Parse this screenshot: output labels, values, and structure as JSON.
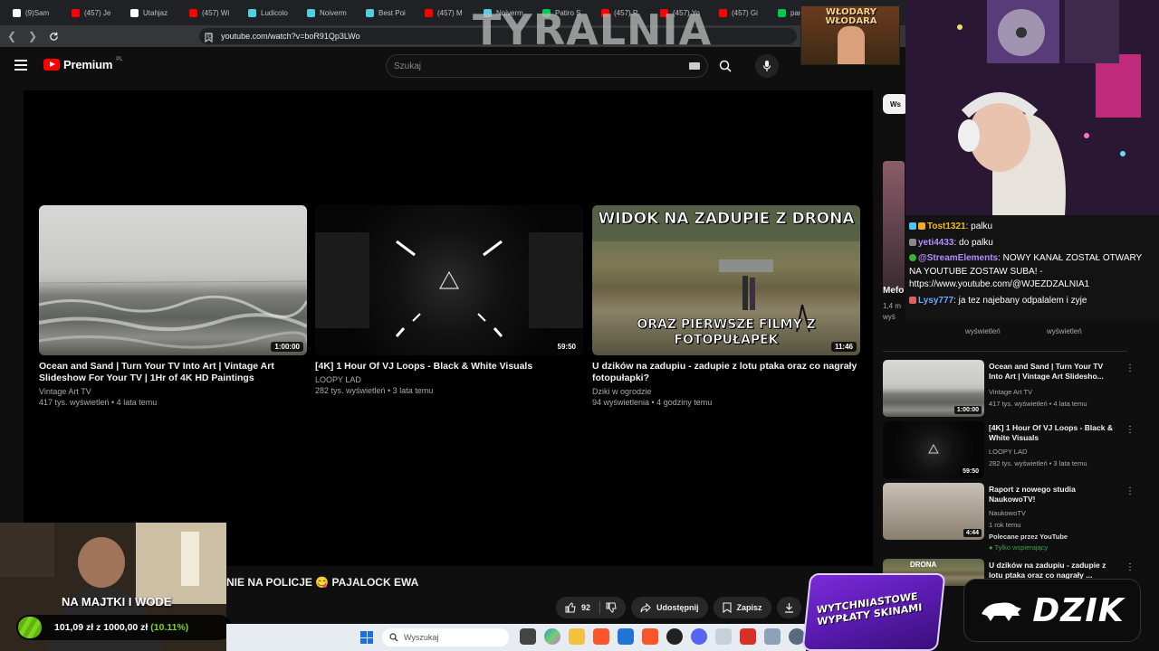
{
  "browser": {
    "tabs": [
      "(9)Sam",
      "(457) Je",
      "Utahjaz",
      "(457) Wi",
      "Ludicolo",
      "Noiverm",
      "Best Poi",
      "(457) M",
      "Noiverm",
      "Patiro S",
      "(457) R",
      "(457) Yo",
      "(457) Gi",
      "paramo"
    ],
    "tab_colors": [
      "#ffffff",
      "#ff0000",
      "#ffffff",
      "#ff0000",
      "#4dd0e1",
      "#4dd0e1",
      "#4dd0e1",
      "#ff0000",
      "#4dd0e1",
      "#00c853",
      "#ff0000",
      "#ff0000",
      "#ff0000",
      "#00c853"
    ],
    "url": "youtube.com/watch?v=boR91Qp3LWo"
  },
  "overlay": {
    "logo": "TYRALNIA",
    "wlodary": "WŁODARY WŁODARA",
    "player_text": "NIE NA POLICJE 😋 PAJALOCK EWA",
    "goal_title": "NA MAJTKI I WODE",
    "goal_current": "101,09 zł",
    "goal_sep": "z",
    "goal_target": "1000,00 zł",
    "goal_percent": "(10.11%)",
    "goal_fraction": 0.1011,
    "brand": "DZIK",
    "promo": "WYTCHNIASTOWE WYPŁATY SKINAMI"
  },
  "youtube": {
    "brand": "Premium",
    "region": "PL",
    "search_placeholder": "Szukaj",
    "endscreen": [
      {
        "title": "Ocean and Sand | Turn Your TV Into Art | Vintage Art Slideshow For Your TV | 1Hr of 4K HD Paintings",
        "channel": "Vintage Art TV",
        "meta": "417 tys. wyświetleń • 4 lata temu",
        "duration": "1:00:00"
      },
      {
        "title": "[4K] 1 Hour Of VJ Loops - Black & White Visuals",
        "channel": "LOOPY LAD",
        "meta": "282 tys. wyświetleń • 3 lata temu",
        "duration": "59:50"
      },
      {
        "title": "U dzików na zadupiu - zadupie z lotu ptaka oraz co nagrały fotopułapki?",
        "channel": "Dziki w ogrodzie",
        "meta": "94 wyświetlenia • 4 godziny temu",
        "duration": "11:46",
        "thumb_top": "WIDOK NA ZADUPIE Z DRONA",
        "thumb_bottom": "ORAZ PIERWSZE FILMY Z FOTOPUŁAPEK"
      }
    ],
    "actions": {
      "likes": "92",
      "share": "Udostępnij",
      "save": "Zapisz"
    },
    "chips": [
      "Ws"
    ],
    "side_partial": {
      "title": "Mefo",
      "meta1": "1,4 m",
      "meta2": "wyś",
      "views_label_1": "wyświetleń",
      "views_label_2": "wyświetleń"
    },
    "recommendations": [
      {
        "title": "Ocean and Sand | Turn Your TV Into Art | Vintage Art Slidesho...",
        "channel": "Vintage Art TV",
        "meta": "417 tys. wyświetleń • 4 lata temu",
        "duration": "1:00:00"
      },
      {
        "title": "[4K] 1 Hour Of VJ Loops - Black & White Visuals",
        "channel": "LOOPY LAD",
        "meta": "282 tys. wyświetleń • 3 lata temu",
        "duration": "59:50"
      },
      {
        "title": "Raport z nowego studia NaukowoTV!",
        "channel": "NaukowoTV",
        "meta": "1 rok temu",
        "extra": "Polecane przez YouTube",
        "badge": "Tylko wspierający",
        "duration": "4:44"
      },
      {
        "title": "U dzików na zadupiu - zadupie z lotu ptaka oraz co nagrały ...",
        "thumb_text": "DRONA"
      }
    ]
  },
  "chat": [
    {
      "user": "Tost1321",
      "color": "#f0c000",
      "text": ": palku"
    },
    {
      "user": "yeti4433",
      "color": "#b58cff",
      "text": ": do palku"
    },
    {
      "user": "@StreamElements",
      "color": "#b58cff",
      "text": ": NOWY KANAŁ ZOSTAŁ OTWARY NA YOUTUBE ZOSTAW SUBA! - https://www.youtube.com/@WJEZDZALNIA1"
    },
    {
      "user": "Lysy777",
      "color": "#6fa8ff",
      "text": ": ja tez najebany odpalalem i zyje"
    }
  ],
  "taskbar": {
    "search_placeholder": "Wyszukaj"
  }
}
